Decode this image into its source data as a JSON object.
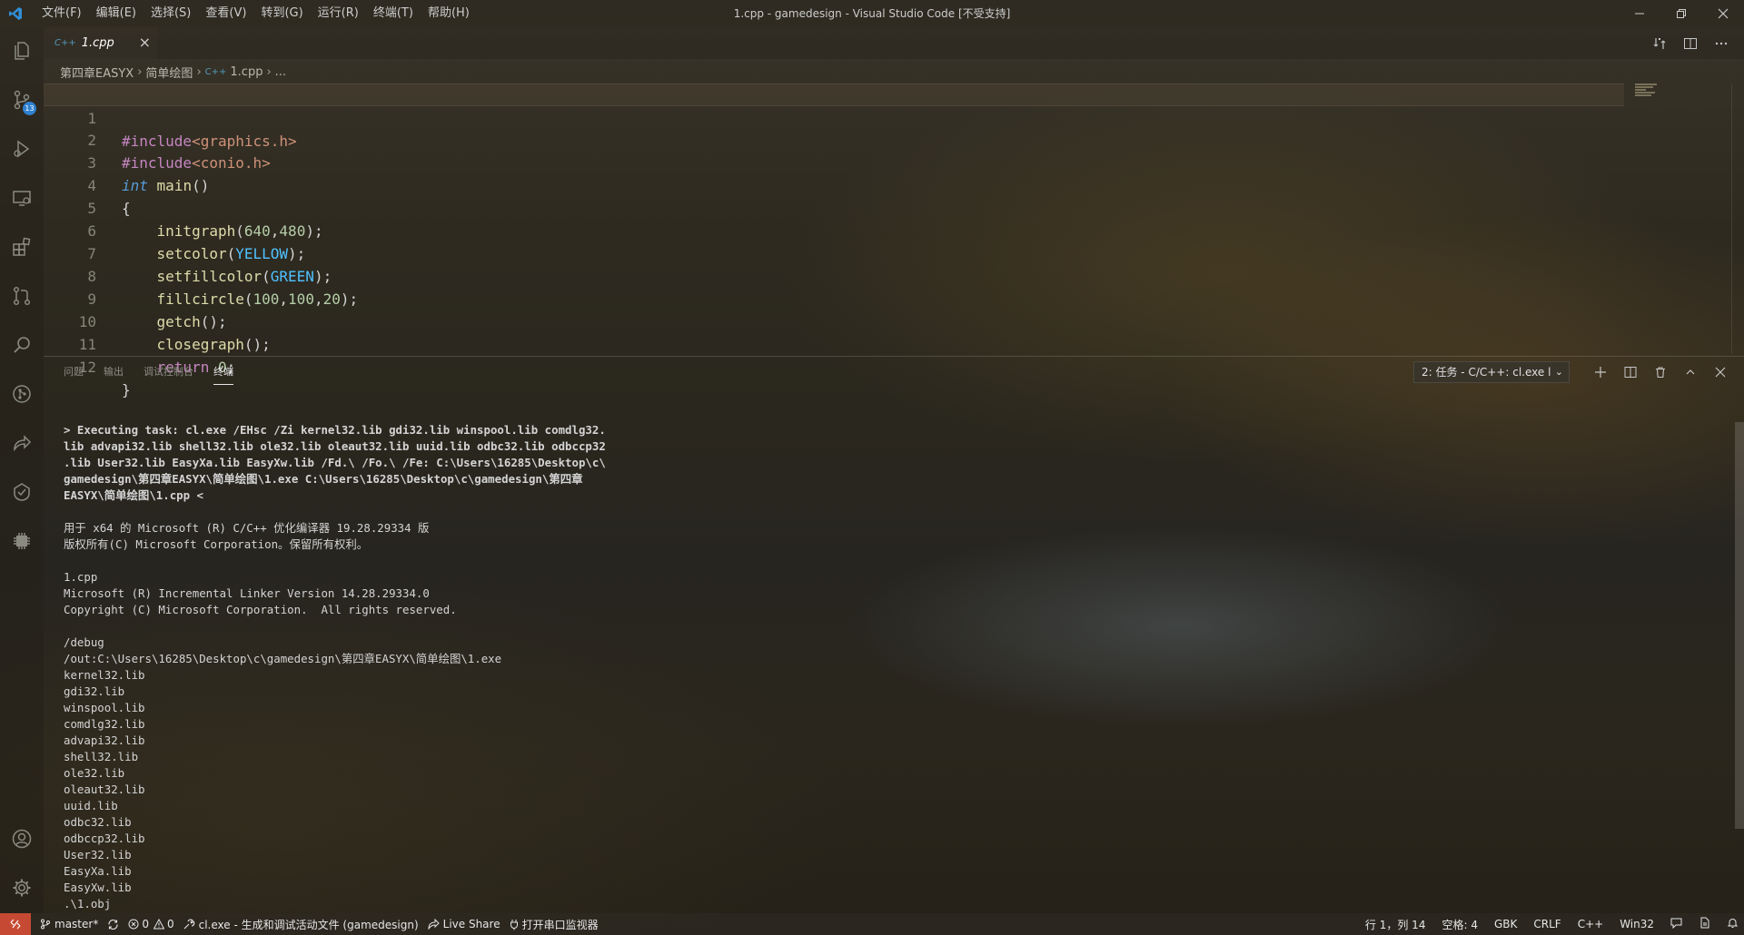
{
  "window": {
    "title": "1.cpp - gamedesign - Visual Studio Code [不受支持]"
  },
  "menu": [
    "文件(F)",
    "编辑(E)",
    "选择(S)",
    "查看(V)",
    "转到(G)",
    "运行(R)",
    "终端(T)",
    "帮助(H)"
  ],
  "activity": {
    "scm_badge": "13"
  },
  "tab": {
    "icon": "C++",
    "label": "1.cpp",
    "close": "×"
  },
  "breadcrumb": {
    "items": [
      "第四章EASYX",
      "简单绘图",
      "1.cpp",
      "..."
    ],
    "file_icon": "C++"
  },
  "editor": {
    "line_numbers": [
      "1",
      "2",
      "3",
      "4",
      "5",
      "6",
      "7",
      "8",
      "9",
      "10",
      "11",
      "12"
    ],
    "code": {
      "l1_pp": "#include",
      "l1_hdr": "<graphics.h>",
      "l2_pp": "#include",
      "l2_hdr": "<conio.h>",
      "l3_type": "int",
      "l3_fn": "main",
      "l3_rest": "()",
      "l4": "{",
      "l5_fn": "initgraph",
      "l5_a": "640",
      "l5_b": "480",
      "l6_fn": "setcolor",
      "l6_arg": "YELLOW",
      "l7_fn": "setfillcolor",
      "l7_arg": "GREEN",
      "l8_fn": "fillcircle",
      "l8_a": "100",
      "l8_b": "100",
      "l8_c": "20",
      "l9_fn": "getch",
      "l10_fn": "closegraph",
      "l11_kw": "return",
      "l11_num": "0",
      "l12": "}"
    }
  },
  "panel": {
    "tabs": [
      "问题",
      "输出",
      "调试控制台",
      "终端"
    ],
    "active_tab": "终端",
    "task_select": "2: 任务 - C/C++: cl.exe l",
    "terminal_bold": [
      "> Executing task: cl.exe /EHsc /Zi kernel32.lib gdi32.lib winspool.lib comdlg32.",
      "lib advapi32.lib shell32.lib ole32.lib oleaut32.lib uuid.lib odbc32.lib odbccp32",
      ".lib User32.lib EasyXa.lib EasyXw.lib /Fd.\\ /Fo.\\ /Fe: C:\\Users\\16285\\Desktop\\c\\",
      "gamedesign\\第四章EASYX\\简单绘图\\1.exe C:\\Users\\16285\\Desktop\\c\\gamedesign\\第四章",
      "EASYX\\简单绘图\\1.cpp <"
    ],
    "compiler_info": [
      "用于 x64 的 Microsoft (R) C/C++ 优化编译器 19.28.29334 版",
      "版权所有(C) Microsoft Corporation。保留所有权利。"
    ],
    "linker_info": [
      "1.cpp",
      "Microsoft (R) Incremental Linker Version 14.28.29334.0",
      "Copyright (C) Microsoft Corporation.  All rights reserved."
    ],
    "link_args": [
      "/debug",
      "/out:C:\\Users\\16285\\Desktop\\c\\gamedesign\\第四章EASYX\\简单绘图\\1.exe",
      "kernel32.lib",
      "gdi32.lib",
      "winspool.lib",
      "comdlg32.lib",
      "advapi32.lib",
      "shell32.lib",
      "ole32.lib",
      "oleaut32.lib",
      "uuid.lib",
      "odbc32.lib",
      "odbccp32.lib",
      "User32.lib",
      "EasyXa.lib",
      "EasyXw.lib",
      ".\\1.obj"
    ]
  },
  "status": {
    "branch": "master*",
    "errors": "0",
    "warnings": "0",
    "task": "cl.exe - 生成和调试活动文件 (gamedesign)",
    "live_share": "Live Share",
    "serial_monitor": "打开串口监视器",
    "position": "行 1，列 14",
    "spaces": "空格: 4",
    "encoding": "GBK",
    "eol": "CRLF",
    "language": "C++",
    "platform": "Win32"
  }
}
